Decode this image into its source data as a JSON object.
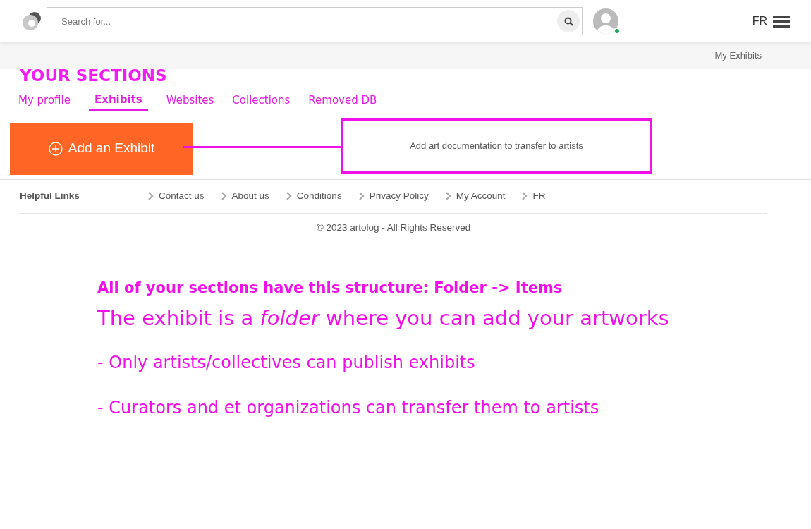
{
  "header": {
    "search": {
      "placeholder": "Search for..."
    },
    "user_online": true,
    "language": "FR"
  },
  "breadcrumb": "My Exhibits",
  "sections_title": "YOUR SECTIONS",
  "tabs": [
    {
      "label": "My profile",
      "selected": false
    },
    {
      "label": "Exhibits",
      "selected": true
    },
    {
      "label": "Websites",
      "selected": false
    },
    {
      "label": "Collections",
      "selected": false
    },
    {
      "label": "Removed DB",
      "selected": false
    }
  ],
  "add_button": "Add an Exhibit",
  "callout": "Add art documentation to transfer to artists",
  "footer": {
    "heading": "Helpful Links",
    "links": [
      "Contact us",
      "About us",
      "Conditions",
      "Privacy Policy",
      "My Account",
      "FR"
    ],
    "copyright": "© 2023 artolog - All Rights Reserved"
  },
  "notes": [
    {
      "kind": "heading",
      "text": "All of your sections have this structure: Folder -> Items"
    },
    {
      "kind": "lead",
      "text": "The exhibit is a *folder* where you can add your artworks"
    },
    {
      "kind": "bullet",
      "text": "- Only artists/collectives can publish exhibits"
    },
    {
      "kind": "bullet",
      "text": "- Curators and et organizations can transfer them to artists"
    }
  ]
}
